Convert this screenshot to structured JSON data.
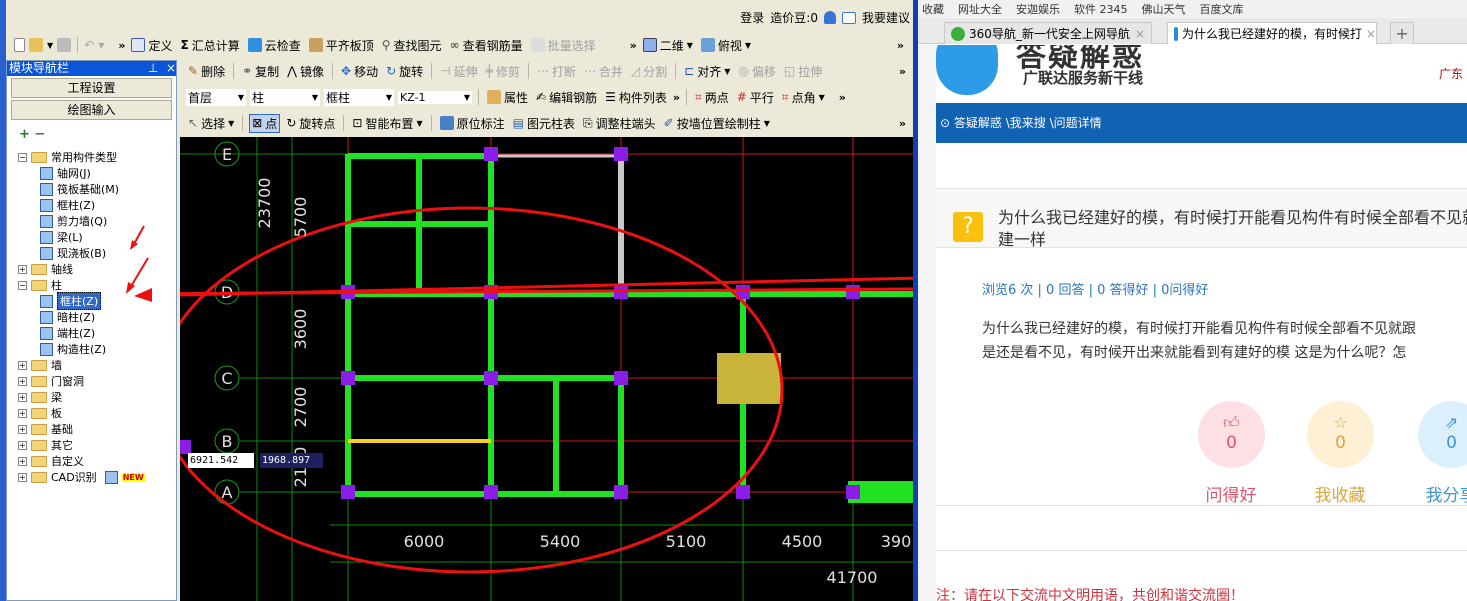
{
  "app": {
    "topbar": {
      "login": "登录",
      "beans": "造价豆:0",
      "suggest": "我要建议"
    },
    "toolbar1": {
      "items": [
        "定义",
        "汇总计算",
        "云检查",
        "平齐板顶",
        "查找图元",
        "查看钢筋量",
        "批量选择"
      ],
      "view_mode": "二维",
      "view_angle": "俯视"
    },
    "toolbar2": {
      "items": [
        "删除",
        "复制",
        "镜像",
        "移动",
        "旋转",
        "延伸",
        "修剪",
        "打断",
        "合并",
        "分割",
        "对齐",
        "偏移",
        "拉伸"
      ]
    },
    "toolbar3": {
      "floor": "首层",
      "category": "柱",
      "type": "框柱",
      "name": "KZ-1",
      "items": [
        "属性",
        "编辑钢筋",
        "构件列表",
        "两点",
        "平行",
        "点角"
      ]
    },
    "toolbar4": {
      "items": [
        "选择",
        "点",
        "旋转点",
        "智能布置",
        "原位标注",
        "图元柱表",
        "调整柱端头",
        "按墙位置绘制柱"
      ]
    },
    "nav": {
      "title": "模块导航栏",
      "buttons": [
        "工程设置",
        "绘图输入"
      ],
      "tree": [
        {
          "label": "常用构件类型",
          "level": 0,
          "expanded": true,
          "folder": true
        },
        {
          "label": "轴网(J)",
          "level": 1
        },
        {
          "label": "筏板基础(M)",
          "level": 1
        },
        {
          "label": "框柱(Z)",
          "level": 1
        },
        {
          "label": "剪力墙(Q)",
          "level": 1
        },
        {
          "label": "梁(L)",
          "level": 1
        },
        {
          "label": "现浇板(B)",
          "level": 1
        },
        {
          "label": "轴线",
          "level": 0,
          "expanded": false,
          "folder": true
        },
        {
          "label": "柱",
          "level": 0,
          "expanded": true,
          "folder": true
        },
        {
          "label": "框柱(Z)",
          "level": 1,
          "selected": true
        },
        {
          "label": "暗柱(Z)",
          "level": 1
        },
        {
          "label": "端柱(Z)",
          "level": 1
        },
        {
          "label": "构造柱(Z)",
          "level": 1
        },
        {
          "label": "墙",
          "level": 0,
          "expanded": false,
          "folder": true
        },
        {
          "label": "门窗洞",
          "level": 0,
          "expanded": false,
          "folder": true
        },
        {
          "label": "梁",
          "level": 0,
          "expanded": false,
          "folder": true
        },
        {
          "label": "板",
          "level": 0,
          "expanded": false,
          "folder": true
        },
        {
          "label": "基础",
          "level": 0,
          "expanded": false,
          "folder": true
        },
        {
          "label": "其它",
          "level": 0,
          "expanded": false,
          "folder": true
        },
        {
          "label": "自定义",
          "level": 0,
          "expanded": false,
          "folder": true
        },
        {
          "label": "CAD识别",
          "level": 0,
          "expanded": false,
          "folder": true,
          "badge": "NEW"
        }
      ]
    },
    "canvas": {
      "axis_labels": [
        "E",
        "D",
        "C",
        "B",
        "A"
      ],
      "vertical_dims": [
        "23700",
        "5700",
        "3600",
        "2700",
        "2100"
      ],
      "horizontal_dims": [
        "6000",
        "5400",
        "5100",
        "4500",
        "390"
      ],
      "total_dim": "41700",
      "coord_x": "6921.542",
      "coord_y": "1968.897"
    }
  },
  "browser": {
    "bookmarks": [
      "收藏",
      "网址大全",
      "安迦娱乐",
      "软件 2345",
      "佛山天气",
      "百度文库"
    ],
    "tabs": [
      {
        "title": "360导航_新一代安全上网导航",
        "active": false
      },
      {
        "title": "为什么我已经建好的模，有时候打",
        "active": true
      }
    ],
    "page": {
      "logo_title": "答疑解惑",
      "logo_subtitle": "广联达服务新干线",
      "corner_text": "广东",
      "breadcrumb": "答疑解惑 \\我来搜 \\问题详情",
      "question_title": "为什么我已经建好的模，有时候打开能看见构件有时候全部看不见就跟没建一样",
      "stats": "浏览6 次 | 0 回答 | 0 答得好 | 0问得好",
      "body_line1": "为什么我已经建好的模，有时候打开能看见构件有时候全部看不见就跟",
      "body_line2": "是还是看不见，有时候开出来就能看到有建好的模  这是为什么呢？怎",
      "actions": [
        {
          "label": "问得好",
          "count": "0",
          "icon": "thumbs-up",
          "color": "#e0566b",
          "bg": "#fde0e4"
        },
        {
          "label": "我收藏",
          "count": "0",
          "icon": "star",
          "color": "#d9a640",
          "bg": "#fdf0d4"
        },
        {
          "label": "我分享",
          "count": "0",
          "icon": "share",
          "color": "#3f95d6",
          "bg": "#dceffc"
        }
      ],
      "notice": "注：请在以下交流中文明用语，共创和谐交流圈！"
    }
  }
}
